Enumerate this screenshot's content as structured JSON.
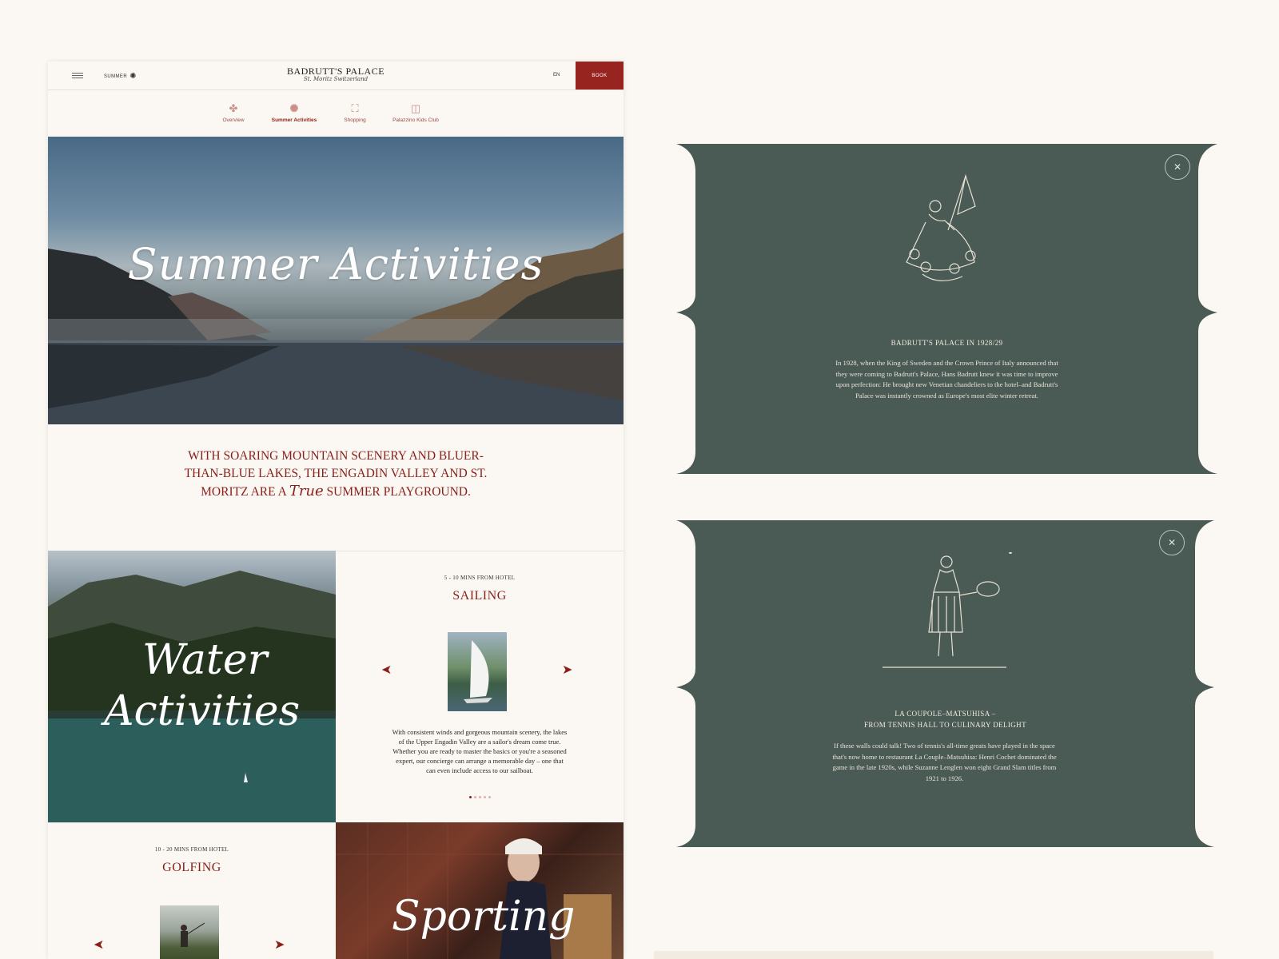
{
  "header": {
    "season": "SUMMER",
    "logo_line1": "BADRUTT'S PALACE",
    "logo_line2": "St. Moritz Switzerland",
    "lang": "EN",
    "book": "BOOK"
  },
  "tabs": [
    {
      "label": "Overview",
      "icon": "flower-icon"
    },
    {
      "label": "Summer Activities",
      "icon": "sun-icon"
    },
    {
      "label": "Shopping",
      "icon": "shopping-bag-icon"
    },
    {
      "label": "Palazzino Kids Club",
      "icon": "kids-club-icon"
    }
  ],
  "hero": {
    "title": "Summer Activities"
  },
  "intro": {
    "line1": "WITH SOARING MOUNTAIN SCENERY AND BLUER-",
    "line2": "THAN-BLUE LAKES, THE ENGADIN VALLEY AND ST.",
    "line3_pre": "MORITZ ARE A",
    "line3_script": "True",
    "line3_post": "SUMMER PLAYGROUND."
  },
  "water": {
    "title_line1": "Water",
    "title_line2": "Activities"
  },
  "sailing": {
    "meta": "5 - 10 MINS FROM HOTEL",
    "title": "SAILING",
    "description": "With consistent winds and gorgeous mountain scenery, the lakes of the Upper Engadin Valley are a sailor's dream come true. Whether you are ready to master the basics or you're a seasoned expert, our concierge can arrange a memorable day – one that can even include access to our sailboat.",
    "dots": 5,
    "active_dot": 0
  },
  "golfing": {
    "meta": "10 - 20 MINS FROM HOTEL",
    "title": "GOLFING"
  },
  "sporting": {
    "title": "Sporting"
  },
  "cards": [
    {
      "title": "BADRUTT'S PALACE IN 1928/29",
      "body": "In 1928, when the King of Sweden and the Crown Prince of Italy announced that they were coming to Badrutt's Palace, Hans Badrutt knew it was time to improve upon perfection: He brought new Venetian chandeliers to the hotel–and Badrutt's Palace was instantly crowned as Europe's most elite winter retreat."
    },
    {
      "title_line1": "LA COUPOLE–MATSUHISA –",
      "title_line2": "FROM TENNIS HALL TO CULINARY DELIGHT",
      "body": "If these walls could talk! Two of tennis's all-time greats have played in the space that's now home to restaurant La Couple–Matsuhisa: Henri Cochet dominated the game in the late 1920s, while Suzanne Lenglen won eight Grand Slam titles from 1921 to 1926."
    }
  ],
  "colors": {
    "brand_red": "#97241f",
    "card_green": "#4a5a54",
    "cream": "#fbf7f2"
  }
}
